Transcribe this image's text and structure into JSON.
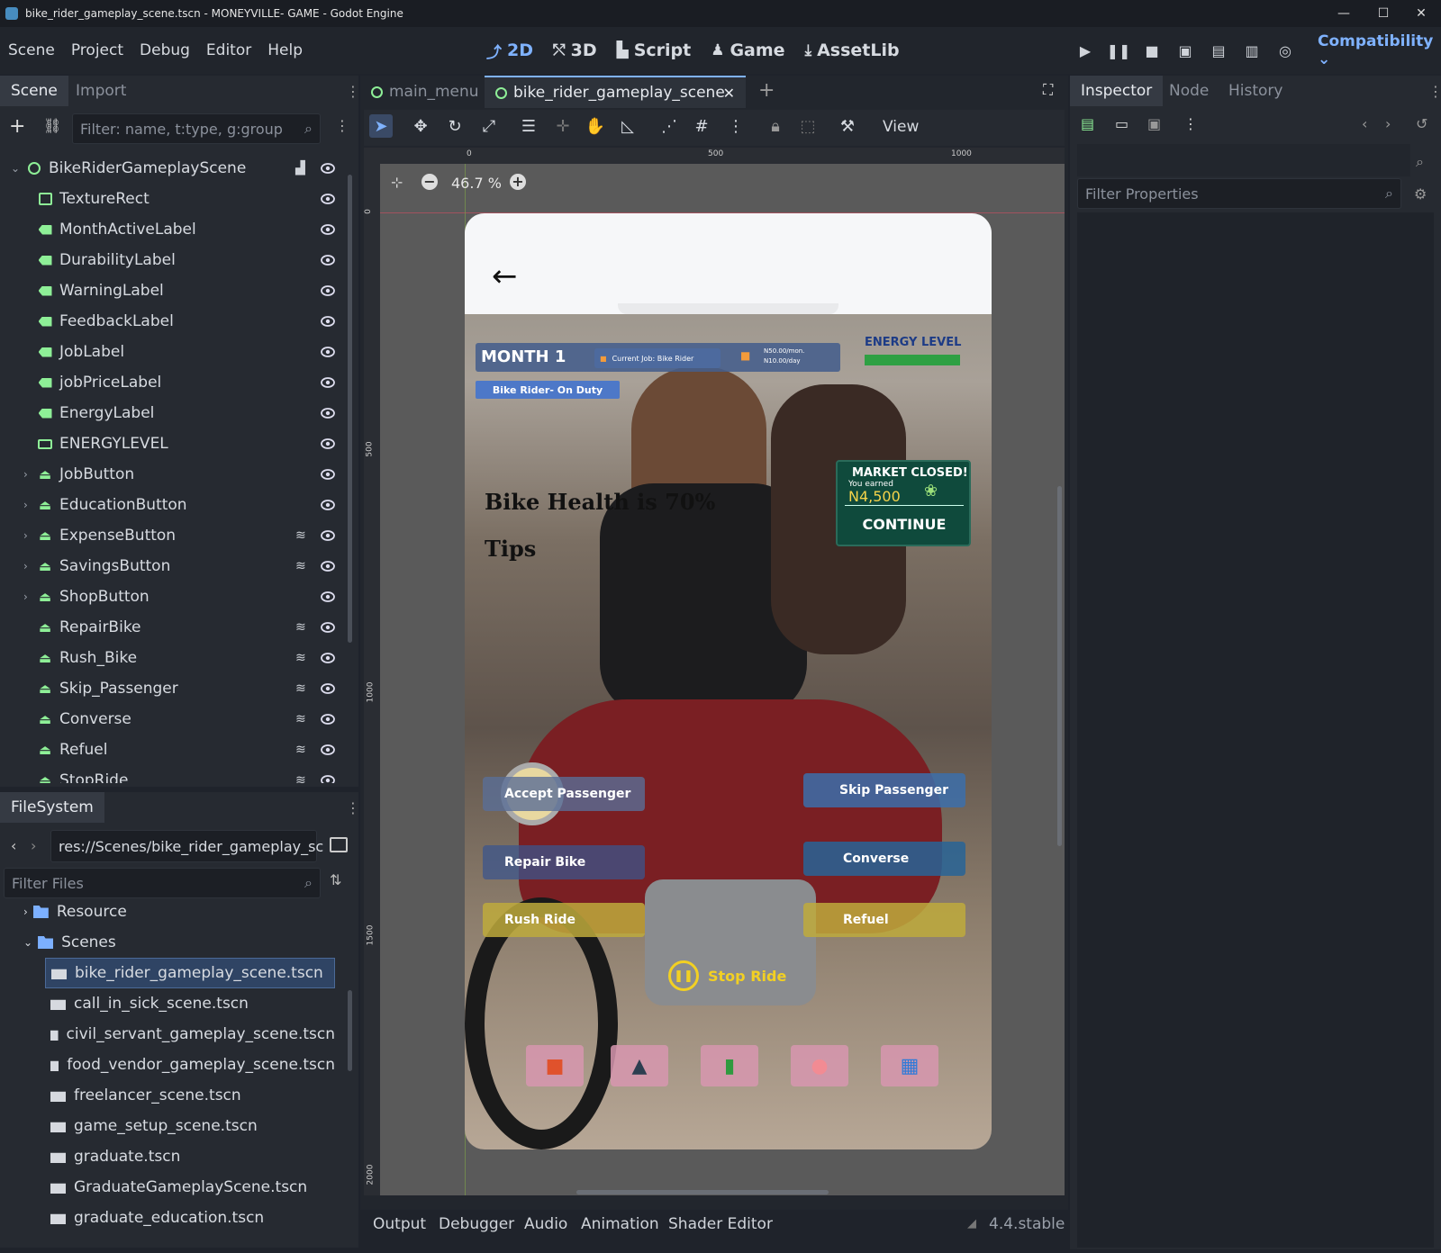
{
  "window": {
    "title": "bike_rider_gameplay_scene.tscn - MONEYVILLE- GAME - Godot Engine",
    "controls": [
      "—",
      "☐",
      "✕"
    ]
  },
  "menu": [
    "Scene",
    "Project",
    "Debug",
    "Editor",
    "Help"
  ],
  "workspaces": [
    {
      "label": "2D",
      "icon": "2d-icon",
      "active": true
    },
    {
      "label": "3D",
      "icon": "3d-icon"
    },
    {
      "label": "Script",
      "icon": "script-icon"
    },
    {
      "label": "Game",
      "icon": "game-icon"
    },
    {
      "label": "AssetLib",
      "icon": "assetlib-icon"
    }
  ],
  "renderer": "Compatibility",
  "scene_dock": {
    "tabs": [
      "Scene",
      "Import"
    ],
    "filter_placeholder": "Filter: name, t:type, g:group",
    "root": "BikeRiderGameplayScene",
    "nodes": [
      {
        "name": "TextureRect",
        "type": "texture"
      },
      {
        "name": "MonthActiveLabel",
        "type": "label"
      },
      {
        "name": "DurabilityLabel",
        "type": "label"
      },
      {
        "name": "WarningLabel",
        "type": "label"
      },
      {
        "name": "FeedbackLabel",
        "type": "label"
      },
      {
        "name": "JobLabel",
        "type": "label"
      },
      {
        "name": "jobPriceLabel",
        "type": "label"
      },
      {
        "name": "EnergyLabel",
        "type": "label"
      },
      {
        "name": "ENERGYLEVEL",
        "type": "bar"
      },
      {
        "name": "JobButton",
        "type": "button",
        "expandable": true
      },
      {
        "name": "EducationButton",
        "type": "button",
        "expandable": true
      },
      {
        "name": "ExpenseButton",
        "type": "button",
        "expandable": true,
        "signal": true
      },
      {
        "name": "SavingsButton",
        "type": "button",
        "expandable": true,
        "signal": true
      },
      {
        "name": "ShopButton",
        "type": "button",
        "expandable": true
      },
      {
        "name": "RepairBike",
        "type": "button",
        "signal": true
      },
      {
        "name": "Rush_Bike",
        "type": "button",
        "signal": true
      },
      {
        "name": "Skip_Passenger",
        "type": "button",
        "signal": true
      },
      {
        "name": "Converse",
        "type": "button",
        "signal": true
      },
      {
        "name": "Refuel",
        "type": "button",
        "signal": true
      },
      {
        "name": "StopRide",
        "type": "button",
        "signal": true
      }
    ]
  },
  "filesystem": {
    "tab": "FileSystem",
    "path": "res://Scenes/bike_rider_gameplay_sc",
    "filter_placeholder": "Filter Files",
    "folders": [
      "Resource",
      "Scenes"
    ],
    "files": [
      "bike_rider_gameplay_scene.tscn",
      "call_in_sick_scene.tscn",
      "civil_servant_gameplay_scene.tscn",
      "food_vendor_gameplay_scene.tscn",
      "freelancer_scene.tscn",
      "game_setup_scene.tscn",
      "graduate.tscn",
      "GraduateGameplayScene.tscn",
      "graduate_education.tscn"
    ],
    "selected": "bike_rider_gameplay_scene.tscn"
  },
  "editor_tabs": [
    "main_menu",
    "bike_rider_gameplay_scene"
  ],
  "toolbar": {
    "view_label": "View",
    "zoom": "46.7 %"
  },
  "ruler": {
    "h": [
      "0",
      "500",
      "1000"
    ],
    "v": [
      "0",
      "500",
      "1000",
      "1500",
      "2000"
    ]
  },
  "game": {
    "back_arrow": "←",
    "month": "MONTH 1",
    "current_job": "Current Job: Bike Rider",
    "pay_line1": "N50.00/mon.",
    "pay_line2": "N10.00/day",
    "energy_label": "ENERGY LEVEL",
    "energy_level": 1.0,
    "duty_badge": "Bike Rider- On Duty",
    "bike_health": "Bike Health is 70%",
    "tips": "Tips",
    "market_title": "MARKET CLOSED!",
    "market_sub": "You earned",
    "market_amount": "N4,500",
    "continue": "CONTINUE",
    "buttons": {
      "accept": "Accept Passenger",
      "skip": "Skip Passenger",
      "repair": "Repair Bike",
      "converse": "Converse",
      "rush": "Rush Ride",
      "refuel": "Refuel",
      "stop": "Stop Ride"
    },
    "bottom_icons": [
      "briefcase-icon",
      "graduation-cap-icon",
      "chart-money-icon",
      "piggy-bank-icon",
      "shop-icon"
    ]
  },
  "inspector": {
    "tabs": [
      "Inspector",
      "Node",
      "History"
    ],
    "filter_placeholder": "Filter Properties"
  },
  "bottom_panel": {
    "tabs": [
      "Output",
      "Debugger",
      "Audio",
      "Animation",
      "Shader Editor"
    ],
    "version": "4.4.stable"
  },
  "colors": {
    "accent": "#7fb2ff",
    "node_green": "#8eef97",
    "energy_bar": "#2ea043"
  }
}
